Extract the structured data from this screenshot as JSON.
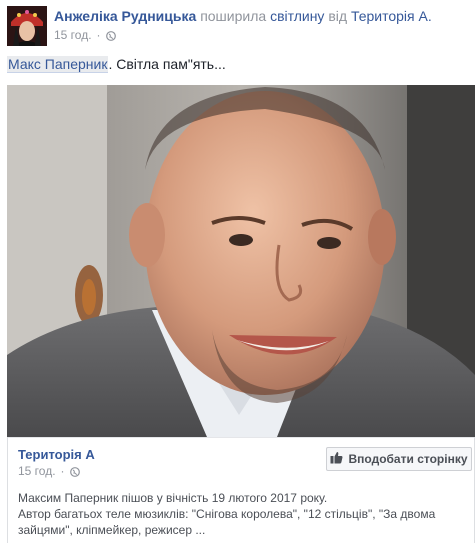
{
  "header": {
    "author": "Анжеліка Рудницька",
    "action": "поширила",
    "object": "світлину",
    "preposition": "від",
    "source_page": "Територія А.",
    "timestamp": "15 год.",
    "separator": "·"
  },
  "post": {
    "mention": "Макс Паперник",
    "text_rest": ". Світла пам\"ять..."
  },
  "attachment": {
    "page_name": "Територія А",
    "timestamp": "15 год.",
    "separator": "·",
    "like_button_label": "Вподобати сторінку",
    "description_line1": "Максим Паперник пішов у вічність 19 лютого 2017 року.",
    "description_line2": "Автор багатьох теле мюзиклів: \"Снігова королева\", \"12 стільців\", \"За двома зайцями\", кліпмейкер, режисер ..."
  },
  "icons": {
    "privacy": "globe-icon",
    "like": "thumbs-up-icon"
  },
  "colors": {
    "link": "#365899",
    "meta": "#90949c",
    "text": "#1d2129"
  }
}
